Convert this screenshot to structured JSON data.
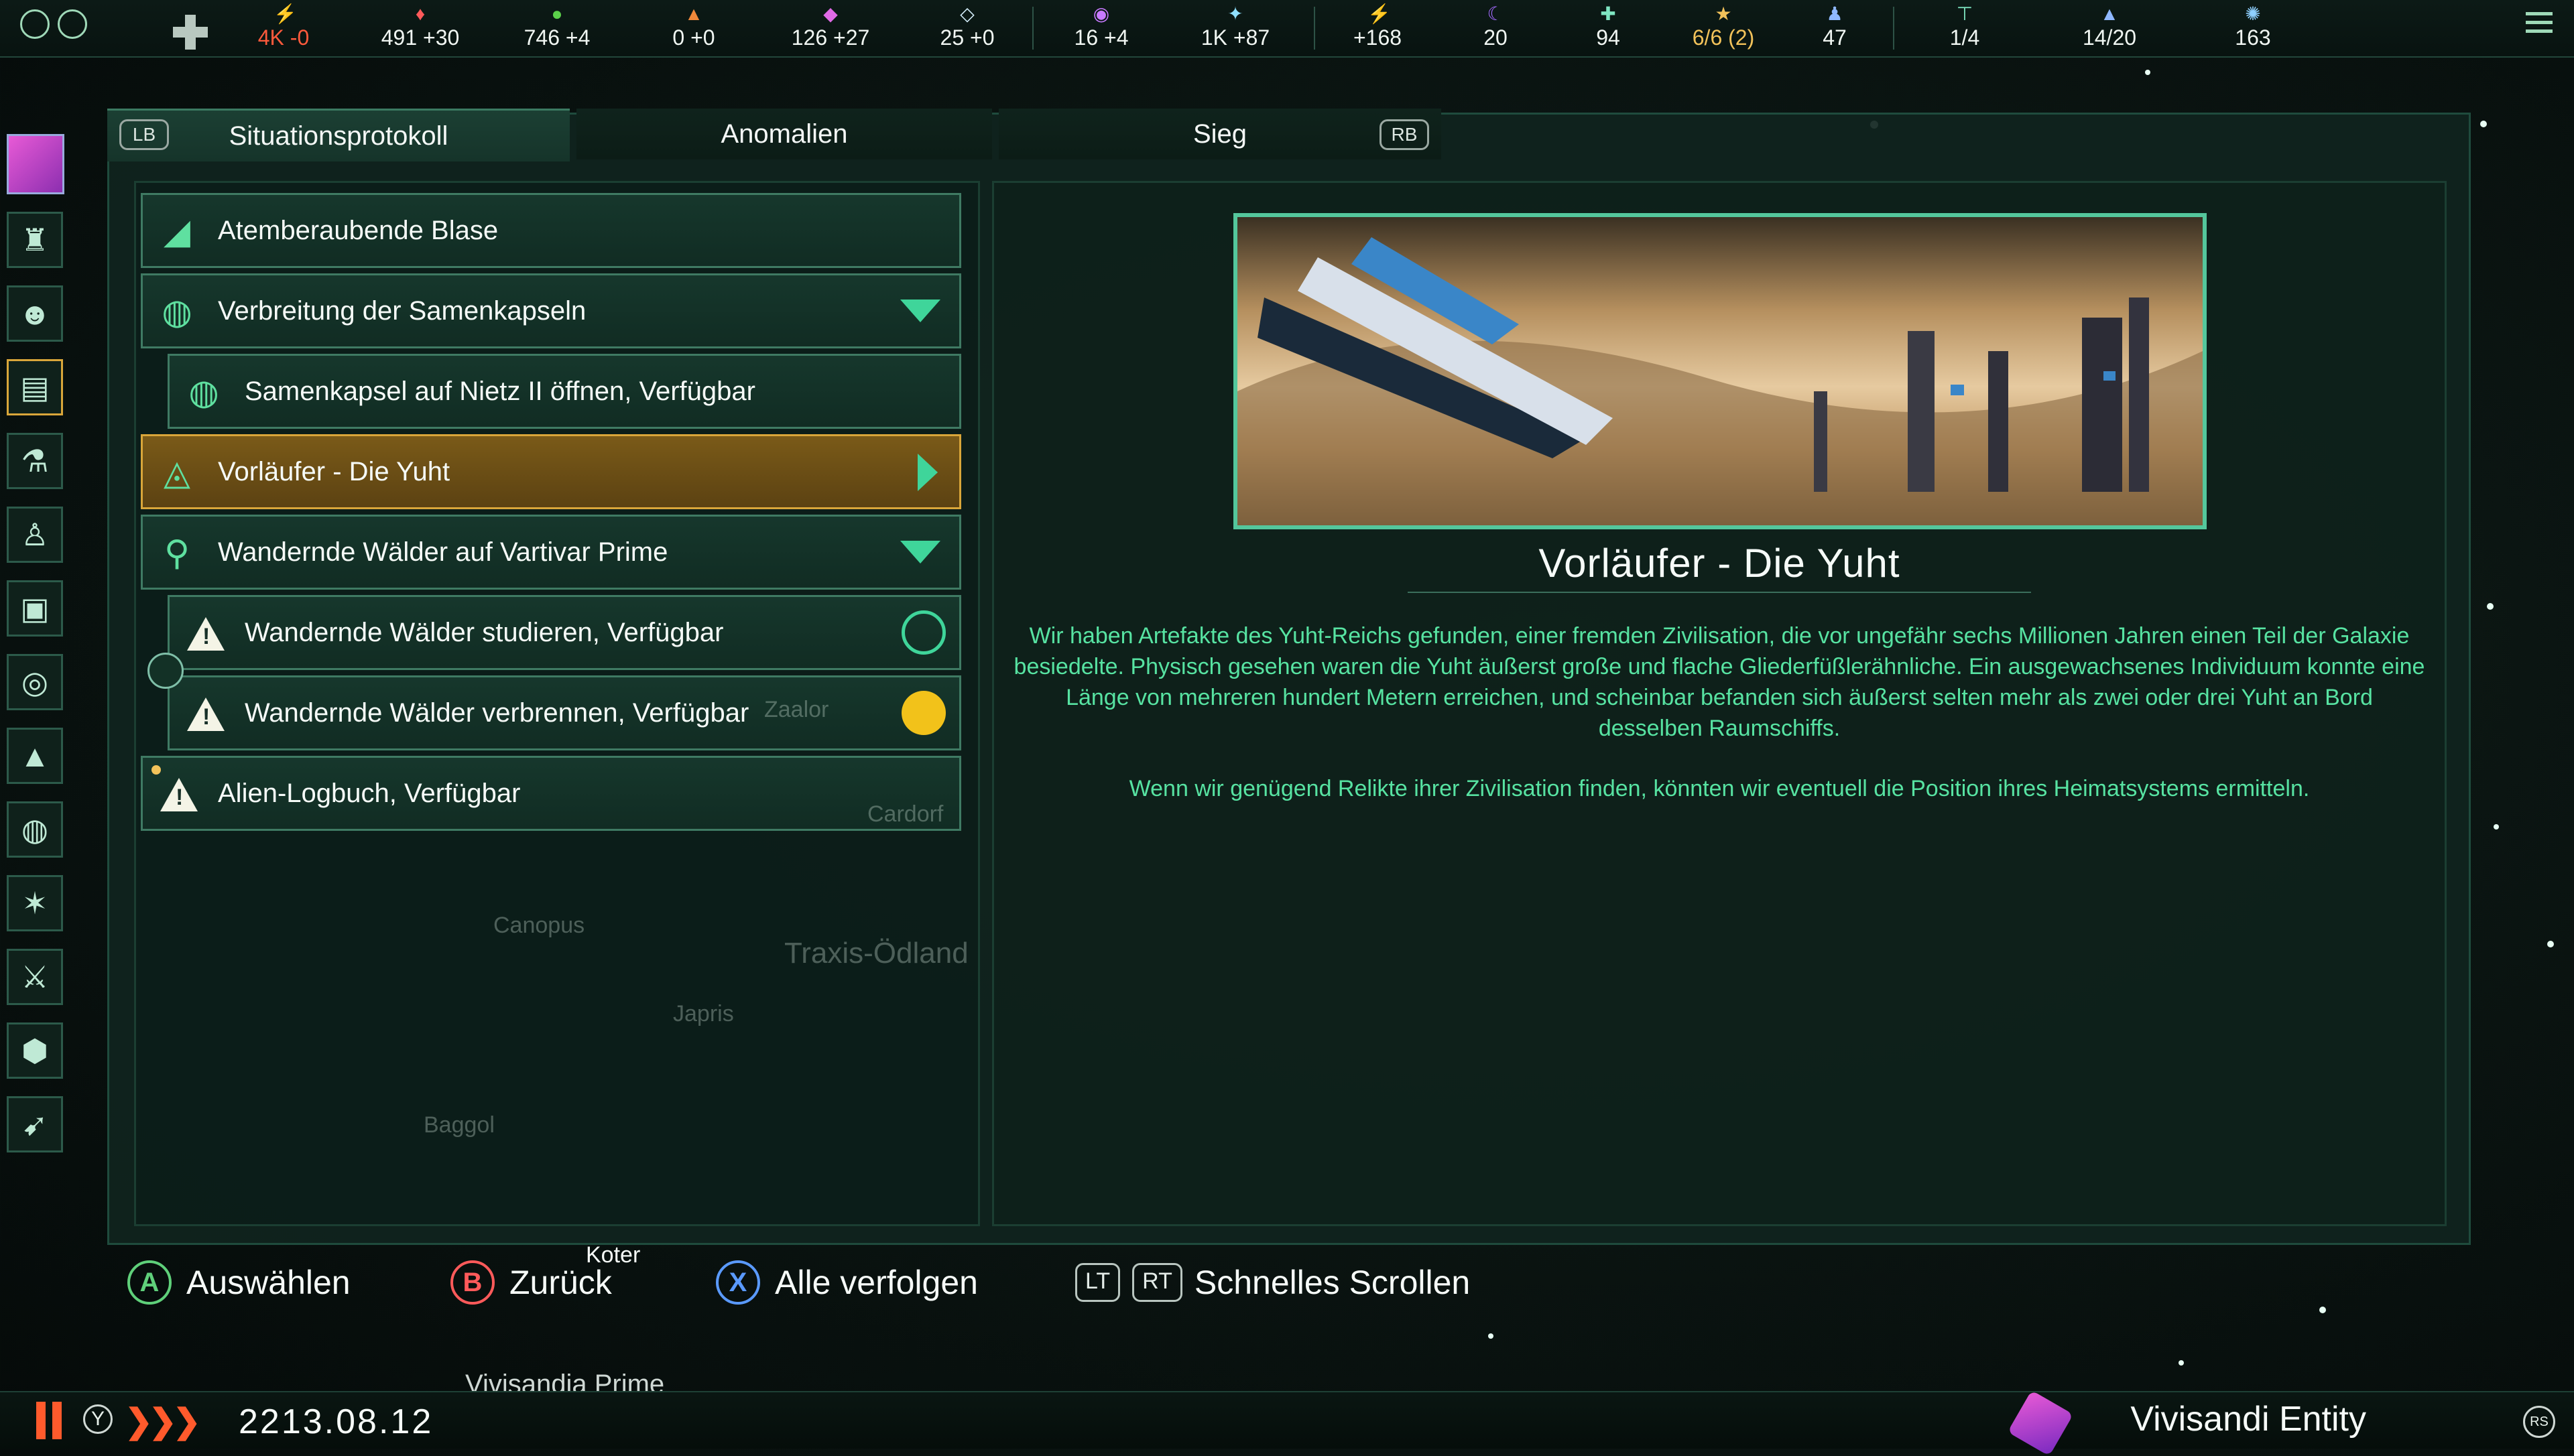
{
  "topbar": {
    "resources": [
      {
        "icon": "energy-icon",
        "value": "4K -0",
        "color": "#ff5a3c"
      },
      {
        "icon": "minerals-icon",
        "value": "491 +30"
      },
      {
        "icon": "food-icon",
        "value": "746 +4"
      },
      {
        "icon": "consumer-goods-icon",
        "value": "0 +0"
      },
      {
        "icon": "alloys-icon",
        "value": "126 +27"
      },
      {
        "icon": "influence-icon",
        "value": "25 +0"
      },
      {
        "icon": "unity-icon",
        "value": "16 +4"
      },
      {
        "icon": "research-icon",
        "value": "1K +87"
      },
      {
        "icon": "trade-icon",
        "value": "+168"
      },
      {
        "icon": "amenities-icon",
        "value": "20"
      },
      {
        "icon": "stability-icon",
        "value": "94"
      },
      {
        "icon": "leaders-icon",
        "value": "6/6 (2)",
        "color": "#f2c25a"
      },
      {
        "icon": "pops-icon",
        "value": "47"
      },
      {
        "icon": "starbases-icon",
        "value": "1/4"
      },
      {
        "icon": "fleet-icon",
        "value": "14/20"
      },
      {
        "icon": "naval-capacity-icon",
        "value": "163"
      }
    ]
  },
  "tabs": {
    "lb": "LB",
    "rb": "RB",
    "items": [
      "Situationsprotokoll",
      "Anomalien",
      "Sieg"
    ]
  },
  "list": {
    "items": [
      {
        "label": "Atemberaubende Blase",
        "icon": "landmark-icon"
      },
      {
        "label": "Verbreitung der Samenkapseln",
        "icon": "planet-spores-icon"
      },
      {
        "label": "Samenkapsel auf Nietz II öffnen, Verfügbar",
        "icon": "planet-spores-icon"
      },
      {
        "label": "Vorläufer - Die Yuht",
        "icon": "precursor-icon"
      },
      {
        "label": "Wandernde Wälder auf Vartivar Prime",
        "icon": "map-pin-icon"
      },
      {
        "label": "Wandernde Wälder studieren, Verfügbar",
        "icon": "warning-icon"
      },
      {
        "label": "Wandernde Wälder verbrennen, Verfügbar",
        "icon": "warning-icon"
      },
      {
        "label": "Alien-Logbuch, Verfügbar",
        "icon": "warning-icon"
      }
    ]
  },
  "detail": {
    "title": "Vorläufer - Die Yuht",
    "paragraphs": [
      "Wir haben Artefakte des Yuht-Reichs gefunden, einer fremden Zivilisation, die vor ungefähr sechs Millionen Jahren einen Teil der Galaxie besiedelte. Physisch gesehen waren die Yuht äußerst große und flache Gliederfüßlerähnliche. Ein ausgewachsenes Individuum konnte eine Länge von mehreren hundert Metern erreichen, und scheinbar befanden sich äußerst selten mehr als zwei oder drei Yuht an Bord desselben Raumschiffs.",
      "Wenn wir genügend Relikte ihrer Zivilisation finden, könnten wir eventuell die Position ihres Heimatsystems ermitteln."
    ]
  },
  "hints": {
    "a_glyph": "A",
    "a_label": "Auswählen",
    "b_glyph": "B",
    "b_label": "Zurück",
    "x_glyph": "X",
    "x_label": "Alle verfolgen",
    "lt": "LT",
    "rt": "RT",
    "scroll_label": "Schnelles Scrollen"
  },
  "bottombar": {
    "y_glyph": "Y",
    "date": "2213.08.12",
    "empire": "Vivisandi Entity",
    "rs": "RS"
  },
  "map_labels": [
    "Koter",
    "Vivisandia Prime",
    "Traxis-Ödland",
    "Canopus",
    "Japris",
    "Baggol",
    "Cardorf",
    "Zaalor"
  ],
  "colors": {
    "accent": "#3fd59a",
    "selected": "#d9a63a",
    "body_text": "#57e3a2",
    "warning": "#ff5a3c"
  }
}
